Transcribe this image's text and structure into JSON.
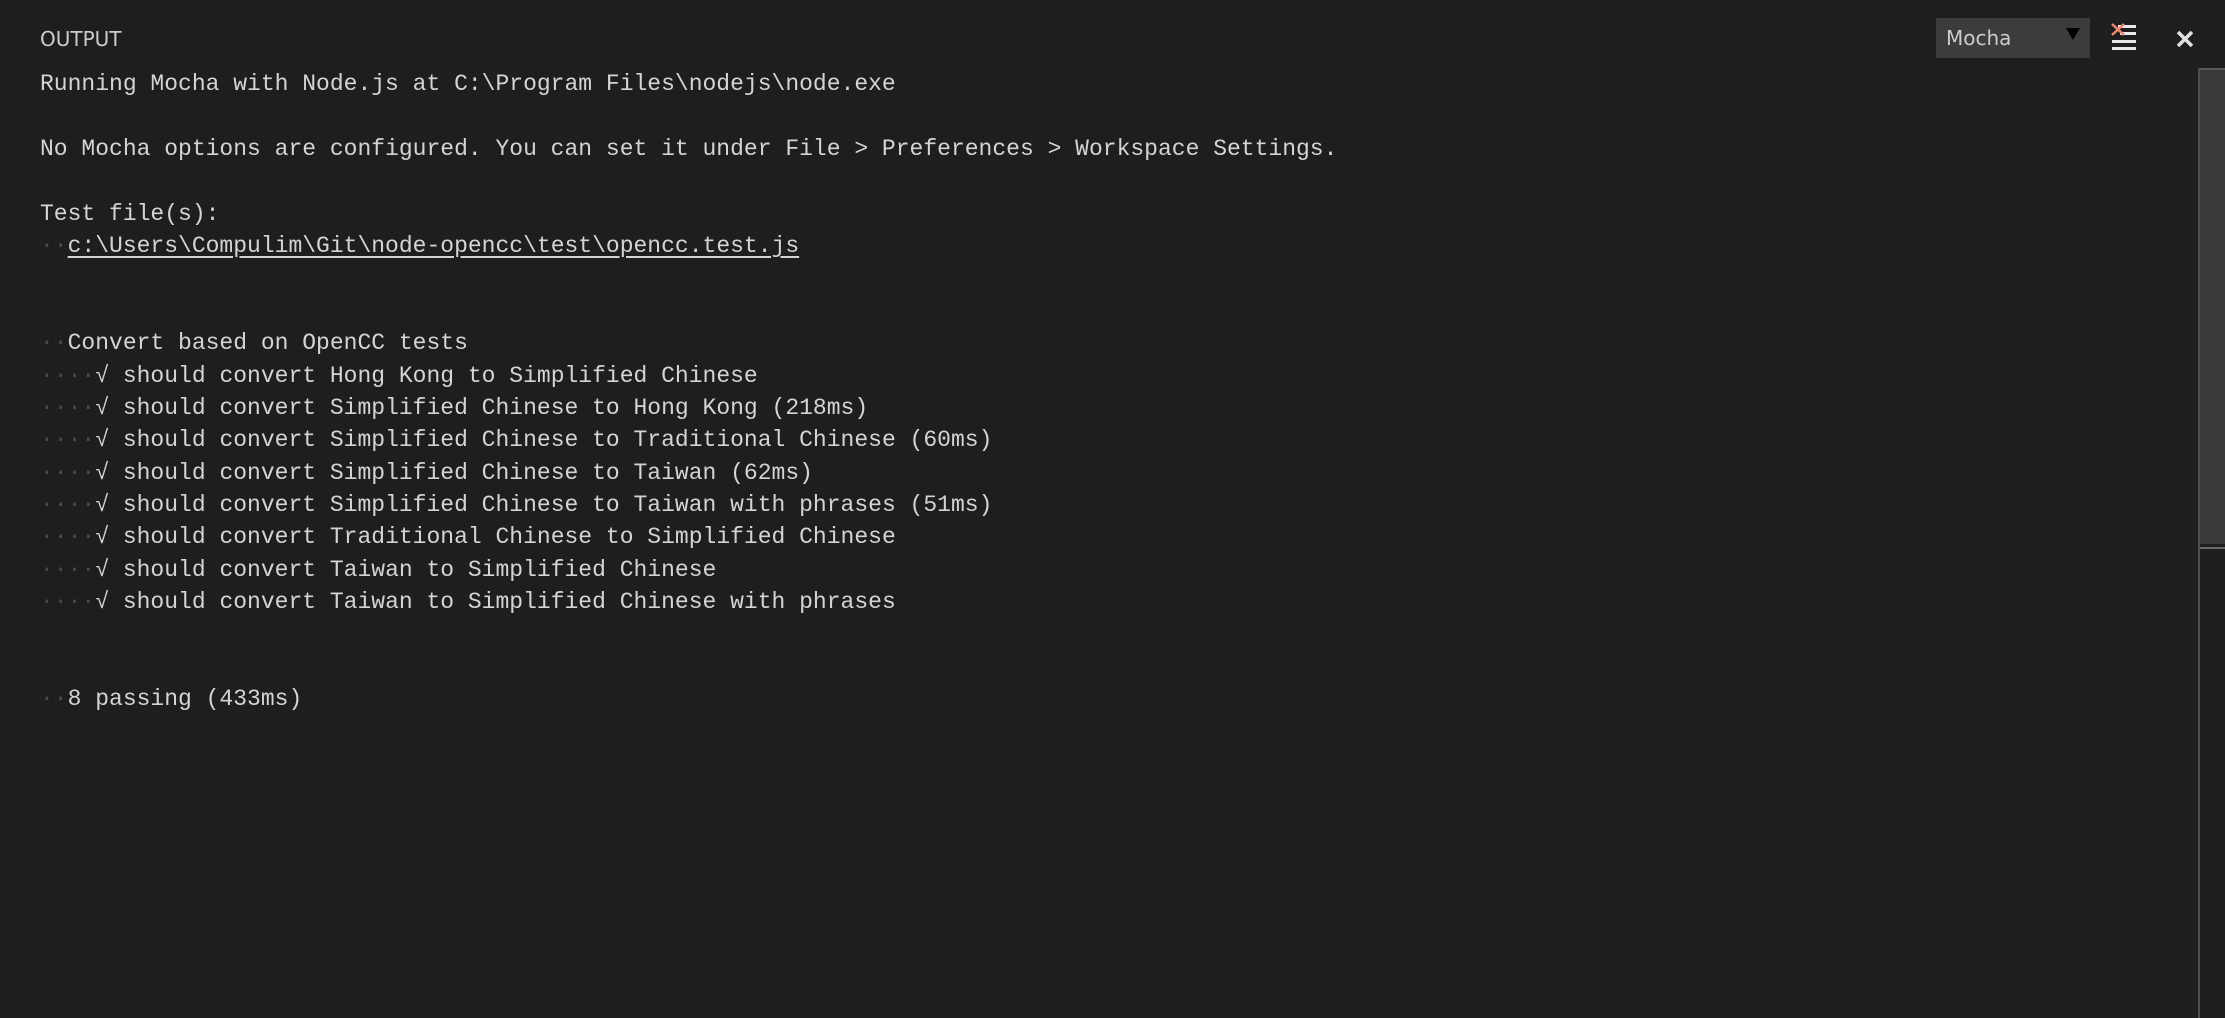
{
  "panel": {
    "title": "OUTPUT",
    "channel_selected": "Mocha",
    "icons": {
      "caret": "dropdown-caret-icon",
      "clear": "clear-output-icon",
      "close": "close-icon"
    },
    "colors": {
      "background": "#1e1e1e",
      "text": "#d4d4d4",
      "whitespace_dot": "#4a4a4a",
      "select_bg": "#3c3c3c",
      "clear_icon_x": "#f48771"
    }
  },
  "output": {
    "lines": [
      {
        "indent": "",
        "text": "Running Mocha with Node.js at C:\\Program Files\\nodejs\\node.exe"
      },
      {
        "indent": "",
        "text": ""
      },
      {
        "indent": "",
        "text": "No Mocha options are configured. You can set it under File > Preferences > Workspace Settings."
      },
      {
        "indent": "",
        "text": ""
      },
      {
        "indent": "",
        "text": "Test file(s):"
      },
      {
        "indent": "··",
        "text": "c:\\Users\\Compulim\\Git\\node-opencc\\test\\opencc.test.js",
        "link": true
      },
      {
        "indent": "",
        "text": ""
      },
      {
        "indent": "",
        "text": ""
      },
      {
        "indent": "··",
        "text": "Convert based on OpenCC tests"
      },
      {
        "indent": "····",
        "text": "√ should convert Hong Kong to Simplified Chinese"
      },
      {
        "indent": "····",
        "text": "√ should convert Simplified Chinese to Hong Kong (218ms)"
      },
      {
        "indent": "····",
        "text": "√ should convert Simplified Chinese to Traditional Chinese (60ms)"
      },
      {
        "indent": "····",
        "text": "√ should convert Simplified Chinese to Taiwan (62ms)"
      },
      {
        "indent": "····",
        "text": "√ should convert Simplified Chinese to Taiwan with phrases (51ms)"
      },
      {
        "indent": "····",
        "text": "√ should convert Traditional Chinese to Simplified Chinese"
      },
      {
        "indent": "····",
        "text": "√ should convert Taiwan to Simplified Chinese"
      },
      {
        "indent": "····",
        "text": "√ should convert Taiwan to Simplified Chinese with phrases"
      },
      {
        "indent": "",
        "text": ""
      },
      {
        "indent": "",
        "text": ""
      },
      {
        "indent": "··",
        "text": "8 passing (433ms)"
      }
    ]
  }
}
